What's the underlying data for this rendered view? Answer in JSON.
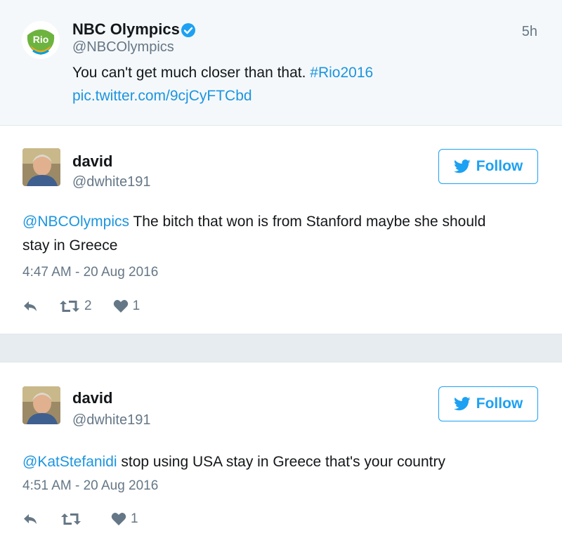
{
  "quoted": {
    "name": "NBC Olympics",
    "handle": "@NBCOlympics",
    "time": "5h",
    "text_plain": "You can't get much closer than that. ",
    "hashtag": "#Rio2016",
    "pic_link": "pic.twitter.com/9cjCyFTCbd",
    "avatar_text": "Rio"
  },
  "tweets": [
    {
      "name": "david",
      "handle": "@dwhite191",
      "follow_label": "Follow",
      "mention": "@NBCOlympics",
      "text": " The bitch that won is from Stanford maybe she should stay in Greece",
      "timestamp": "4:47 AM - 20 Aug 2016",
      "retweets": "2",
      "likes": "1"
    },
    {
      "name": "david",
      "handle": "@dwhite191",
      "follow_label": "Follow",
      "mention": "@KatStefanidi",
      "text": " stop using USA stay in Greece that's your country",
      "timestamp": "4:51 AM - 20 Aug 2016",
      "retweets": "",
      "likes": "1"
    }
  ],
  "colors": {
    "link": "#1b95e0",
    "follow": "#1da1f2",
    "muted": "#657786",
    "background": "#e6ecf0"
  },
  "icons": [
    "verified-badge-icon",
    "twitter-bird-icon",
    "reply-icon",
    "retweet-icon",
    "heart-icon"
  ]
}
